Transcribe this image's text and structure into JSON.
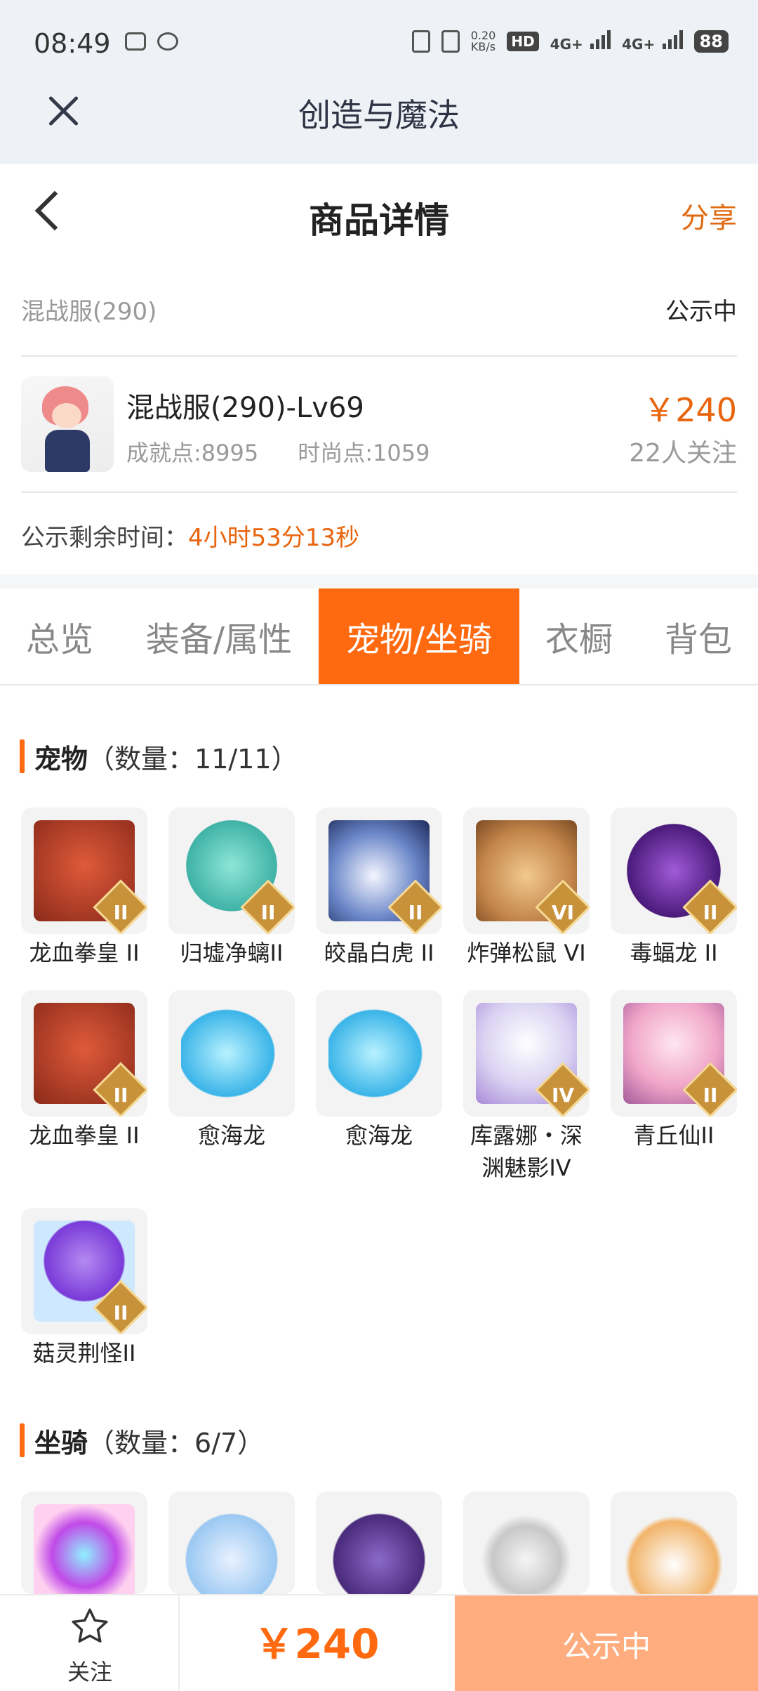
{
  "status_bar": {
    "time": "08:49",
    "net_speed_value": "0.20",
    "net_speed_unit": "KB/s",
    "hd_label": "HD",
    "signal1": "4G+",
    "signal2": "4G+",
    "battery": "88"
  },
  "app_bar": {
    "title": "创造与魔法"
  },
  "header": {
    "title": "商品详情",
    "share": "分享"
  },
  "server": {
    "name": "混战服(290)",
    "status": "公示中"
  },
  "character": {
    "name": "混战服(290)-Lv69",
    "achievement": "成就点:8995",
    "fashion": "时尚点:1059",
    "price": "￥240",
    "watchers": "22人关注"
  },
  "remaining": {
    "label": "公示剩余时间：",
    "value": "4小时53分13秒"
  },
  "tabs": [
    "总览",
    "装备/属性",
    "宠物/坐骑",
    "衣橱",
    "背包"
  ],
  "active_tab": "宠物/坐骑",
  "pets": {
    "label": "宠物",
    "count": "（数量：11/11）",
    "items": [
      {
        "name": "龙血拳皇 II",
        "badge": "II"
      },
      {
        "name": "归墟净螭II",
        "badge": "II"
      },
      {
        "name": "皎晶白虎 II",
        "badge": "II"
      },
      {
        "name": "炸弹松鼠 VI",
        "badge": "VI"
      },
      {
        "name": "毒蝠龙 II",
        "badge": "II"
      },
      {
        "name": "龙血拳皇 II",
        "badge": "II"
      },
      {
        "name": "愈海龙",
        "badge": ""
      },
      {
        "name": "愈海龙",
        "badge": ""
      },
      {
        "name": "库露娜・深渊魅影IV",
        "badge": "IV"
      },
      {
        "name": "青丘仙II",
        "badge": "II"
      },
      {
        "name": "菇灵荆怪II",
        "badge": "II"
      }
    ]
  },
  "mounts": {
    "label": "坐骑",
    "count": "（数量：6/7）"
  },
  "bottom": {
    "follow": "关注",
    "price": "￥240",
    "status_button": "公示中"
  },
  "colors": {
    "accent": "#ff6a10",
    "price": "#e8650e",
    "button": "#ffad7f"
  }
}
